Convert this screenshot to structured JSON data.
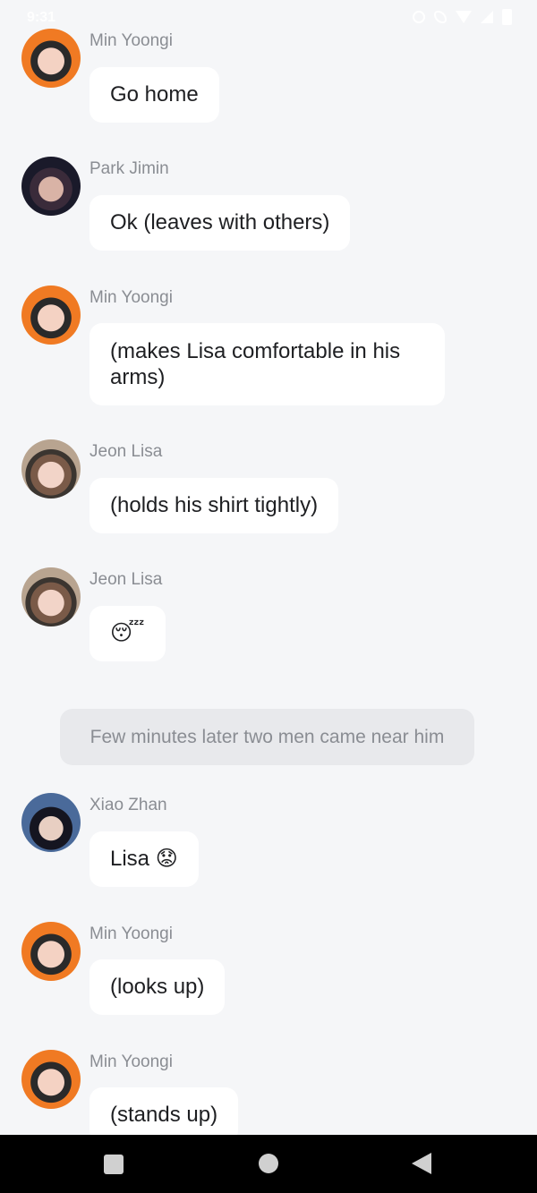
{
  "status_bar": {
    "time": "9:31",
    "icons": [
      "alarm-icon",
      "phone-icon",
      "wifi-icon",
      "signal-icon",
      "battery-icon"
    ]
  },
  "messages": [
    {
      "sender": "Min Yoongi",
      "text": "Go home"
    },
    {
      "sender": "Park Jimin",
      "text": "Ok (leaves with others)"
    },
    {
      "sender": "Min Yoongi",
      "text": "(makes Lisa comfortable in his arms)"
    },
    {
      "sender": "Jeon Lisa",
      "text": "(holds his shirt tightly)"
    },
    {
      "sender": "Jeon Lisa",
      "text": "😴"
    },
    {
      "sender": "Xiao Zhan",
      "text": "Lisa 😟"
    },
    {
      "sender": "Min Yoongi",
      "text": "(looks up)"
    },
    {
      "sender": "Min Yoongi",
      "text": "(stands up)"
    }
  ],
  "narration": "Few minutes later two men came near him",
  "nav_bar": {
    "buttons": [
      "recents-button",
      "home-button",
      "back-button"
    ]
  },
  "colors": {
    "background": "#f5f6f8",
    "bubble": "#ffffff",
    "narration_bg": "#e8e9ec",
    "sender_text": "#8a8d93",
    "message_text": "#1e1f22",
    "nav_bar": "#000000"
  }
}
